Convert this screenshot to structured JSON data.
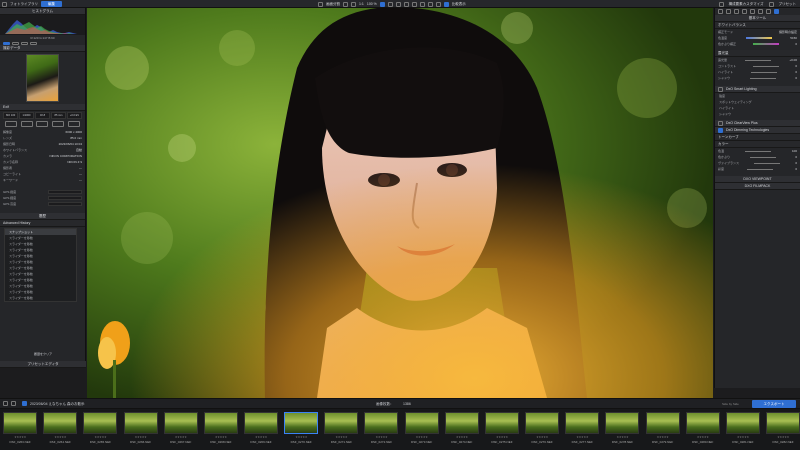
{
  "topbar": {
    "library_tab": "フォトライブラリ",
    "edit_tab": "編集",
    "view_mode": "画面分割",
    "zoom_ratio": "1:1",
    "zoom_percent": "100 %",
    "compare_label": "比較表示",
    "workspace_label": "構成要素カスタマイズ",
    "preset_label": "プリセット"
  },
  "left_panel": {
    "histogram_title": "ヒストグラム",
    "histogram_values": "R:120 G:147 B:90",
    "exif_title": "撮影データ",
    "info_title": "Exif",
    "exif_values": [
      "ISO 100",
      "1/1000",
      "f/2.8",
      "85 mm",
      "+0.0 EV"
    ],
    "meta_rows": [
      {
        "label": "解像度",
        "value": "6000 x 4000"
      },
      {
        "label": "レンズ",
        "value": "85.0 mm"
      },
      {
        "label": "撮影日時",
        "value": "2023/06/04 10:04"
      },
      {
        "label": "ホワイトバランス",
        "value": "自動"
      },
      {
        "label": "カメラ",
        "value": "NIKON CORPORATION"
      },
      {
        "label": "カメラ名称",
        "value": "NIKON Z 9"
      },
      {
        "label": "撮影者",
        "value": "—"
      },
      {
        "label": "コピーライト",
        "value": "—"
      },
      {
        "label": "キーワード",
        "value": "—"
      }
    ],
    "gps_rows": [
      "GPS 緯度",
      "GPS 経度",
      "GPS 高度"
    ],
    "history_title": "履歴",
    "advanced_title": "Advanced History",
    "history_items": [
      "スナップショット",
      "スライダーを移動",
      "スライダーを移動",
      "スライダーを移動",
      "スライダーを移動",
      "スライダーを移動",
      "スライダーを移動",
      "スライダーを移動",
      "スライダーを移動",
      "スライダーを移動",
      "スライダーを移動",
      "スライダーを移動"
    ],
    "history_footer": "履歴をクリア",
    "footer_label": "プリセットエディタ"
  },
  "right_panel": {
    "basic_tools": "基本ツール",
    "wb_title": "ホワイトバランス",
    "wb_rows": [
      {
        "label": "補正モード",
        "value": "撮影時の設定"
      },
      {
        "label": "色温度",
        "value": "5150"
      },
      {
        "label": "色かぶり補正",
        "value": "0"
      }
    ],
    "exposure_title": "露光量",
    "exposure_rows": [
      {
        "label": "露光量",
        "value": "+0.00"
      },
      {
        "label": "コントラスト",
        "value": "0"
      },
      {
        "label": "ハイライト",
        "value": "0"
      },
      {
        "label": "シャドウ",
        "value": "0"
      }
    ],
    "smart_lighting": "DxO Smart Lighting",
    "smart_rows": [
      "強度",
      "スポットウェイティング",
      "ハイライト",
      "シャドウ"
    ],
    "clearview_title": "DxO ClearView Plus",
    "tone_title": "DxO Dimming Technologies",
    "clarity_title": "トーンカーブ",
    "vibrancy_title": "カラー",
    "color_rows": [
      {
        "label": "色温",
        "value": "100"
      },
      {
        "label": "色かぶり",
        "value": "0"
      },
      {
        "label": "ヴァイブランス",
        "value": "0"
      },
      {
        "label": "彩度",
        "value": "0"
      }
    ],
    "viewpoint": "DXO VIEWPOINT",
    "filmpack": "DXO FILMPACK"
  },
  "filmstrip_toolbar": {
    "folder_path": "2023/06/04 えなちゃん 森のお散歩",
    "image_count": "画像枚数：",
    "count_value": "1386",
    "side_by_side": "Side by Side",
    "export_button": "エクスポート"
  },
  "filmstrip": {
    "items": [
      {
        "name": "DSF_0263.NEF",
        "selected": false
      },
      {
        "name": "DSF_0264.NEF",
        "selected": false
      },
      {
        "name": "DSF_0265.NEF",
        "selected": false
      },
      {
        "name": "DSF_0266.NEF",
        "selected": false
      },
      {
        "name": "DSF_0267.NEF",
        "selected": false
      },
      {
        "name": "DSF_0268.NEF",
        "selected": false
      },
      {
        "name": "DSF_0269.NEF",
        "selected": false
      },
      {
        "name": "DSF_0270.NEF",
        "selected": true
      },
      {
        "name": "DSF_0271.NEF",
        "selected": false
      },
      {
        "name": "DSF_0272.NEF",
        "selected": false
      },
      {
        "name": "DSF_0273.NEF",
        "selected": false
      },
      {
        "name": "DSF_0274.NEF",
        "selected": false
      },
      {
        "name": "DSF_0275.NEF",
        "selected": false
      },
      {
        "name": "DSF_0276.NEF",
        "selected": false
      },
      {
        "name": "DSF_0277.NEF",
        "selected": false
      },
      {
        "name": "DSF_0278.NEF",
        "selected": false
      },
      {
        "name": "DSF_0279.NEF",
        "selected": false
      },
      {
        "name": "DSF_0280.NEF",
        "selected": false
      },
      {
        "name": "DSF_0281.NEF",
        "selected": false
      },
      {
        "name": "DSF_0282.NEF",
        "selected": false
      }
    ]
  },
  "colors": {
    "accent": "#2f6fd2",
    "panel_bg": "#252629",
    "section_bg": "#2e2f33",
    "warm_glow": "#f5b53a"
  },
  "icons": [
    "search-icon",
    "gear-icon",
    "star-icon",
    "eye-icon",
    "histogram-icon",
    "grid-icon",
    "export-icon"
  ]
}
